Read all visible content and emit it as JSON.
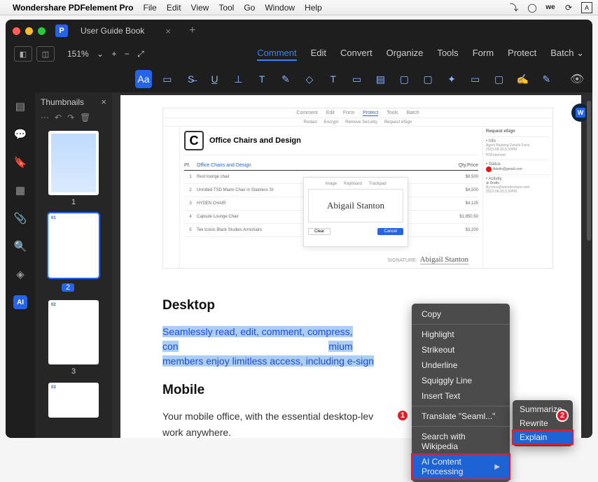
{
  "menubar": {
    "app_title": "Wondershare PDFelement Pro",
    "items": [
      "File",
      "Edit",
      "View",
      "Tool",
      "Go",
      "Window",
      "Help"
    ]
  },
  "window": {
    "tab_title": "User Guide Book",
    "zoom": "151%",
    "topmenu": {
      "comment": "Comment",
      "edit": "Edit",
      "convert": "Convert",
      "organize": "Organize",
      "tools": "Tools",
      "form": "Form",
      "protect": "Protect",
      "batch": "Batch"
    }
  },
  "thumbnails": {
    "title": "Thumbnails",
    "pages": [
      "1",
      "2",
      "3"
    ]
  },
  "page_preview": {
    "topbar_items": [
      "Comment",
      "Edit",
      "Form",
      "Protect",
      "Tools",
      "Batch"
    ],
    "topbar2_items": [
      "Redact",
      "Encrypt",
      "Remove Security",
      "Request eSign"
    ],
    "sidebox": {
      "request": "Request eSign",
      "info_label": "Info",
      "info_file": "Agent Banking Details Form",
      "info_date": "2023-08-20,5:30PM",
      "status_label": "PDFelement",
      "status_email": "Adelin@gmail.com",
      "activity": "Activity",
      "drafts": "Drafts",
      "drafts_by": "By:mice@wondershare.com",
      "drafts_date": "2023-08-20,5:30PM"
    },
    "doc_title": "Office Chairs and Design",
    "table": {
      "header_left": "Pf.",
      "header_desc": "Office Chairs and Design",
      "header_qty": "Qty.",
      "header_price": "Price",
      "rows": [
        {
          "n": "1",
          "name": "Rest lounge chair",
          "price": "$8,500"
        },
        {
          "n": "2",
          "name": "Unrolled TSD Miami Chair in Stainless St",
          "price": "$4,500"
        },
        {
          "n": "3",
          "name": "HYDEN CHAIR",
          "price": "$4,125"
        },
        {
          "n": "4",
          "name": "Capsule Lounge Chair",
          "price": "$1,850.50"
        },
        {
          "n": "5",
          "name": "Tek Iconic Black Studies Armchairs",
          "price": "$3,200"
        }
      ],
      "signature_label": "SIGNATURE:",
      "signature_text": "Abigail Stanton"
    },
    "sigdialog": {
      "tabs": [
        "Image",
        "Keyboard",
        "Trackpad"
      ],
      "signature": "Abigail Stanton",
      "clear": "Clear",
      "cancel": "Cancel"
    }
  },
  "doc": {
    "h_desktop": "Desktop",
    "p1a": "Seamlessly read, edit, comment, compress, con",
    "p1b": "mium",
    "p2": "members enjoy limitless access, including e-sign",
    "h_mobile": "Mobile",
    "p3": "Your mobile office, with the essential desktop-lev",
    "p4": "work anywhere."
  },
  "context_menu": {
    "copy": "Copy",
    "highlight": "Highlight",
    "strikeout": "Strikeout",
    "underline": "Underline",
    "squiggly": "Squiggly Line",
    "insert": "Insert Text",
    "translate": "Translate \"Seaml...\"",
    "wikipedia": "Search with Wikipedia",
    "ai": "AI Content Processing"
  },
  "submenu": {
    "summarize": "Summarize",
    "rewrite": "Rewrite",
    "explain": "Explain"
  },
  "callouts": {
    "one": "1",
    "two": "2"
  }
}
